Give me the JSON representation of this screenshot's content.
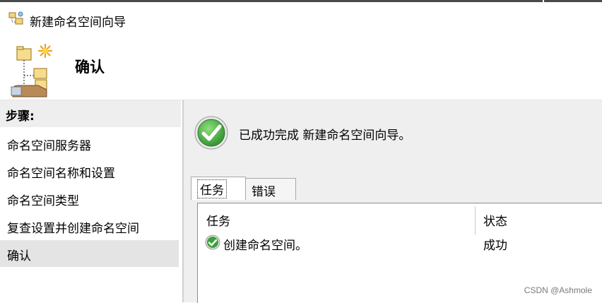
{
  "window": {
    "title": "新建命名空间向导"
  },
  "header": {
    "title": "确认"
  },
  "sidebar": {
    "heading": "步骤:",
    "steps": [
      {
        "label": "命名空间服务器"
      },
      {
        "label": "命名空间名称和设置"
      },
      {
        "label": "命名空间类型"
      },
      {
        "label": "复查设置并创建命名空间"
      },
      {
        "label": "确认",
        "active": true
      }
    ]
  },
  "main": {
    "message": "已成功完成 新建命名空间向导。",
    "tabs": [
      {
        "label": "任务",
        "selected": true
      },
      {
        "label": "错误",
        "selected": false
      }
    ],
    "table": {
      "columns": [
        "任务",
        "状态"
      ],
      "rows": [
        {
          "task": "创建命名空间。",
          "status": "成功",
          "icon": "check-circle-icon"
        }
      ]
    }
  },
  "watermark": "CSDN @Ashmole",
  "colors": {
    "success_green": "#3aa23a",
    "active_step": "#e4e4e4",
    "panel_bg": "#efefef"
  }
}
